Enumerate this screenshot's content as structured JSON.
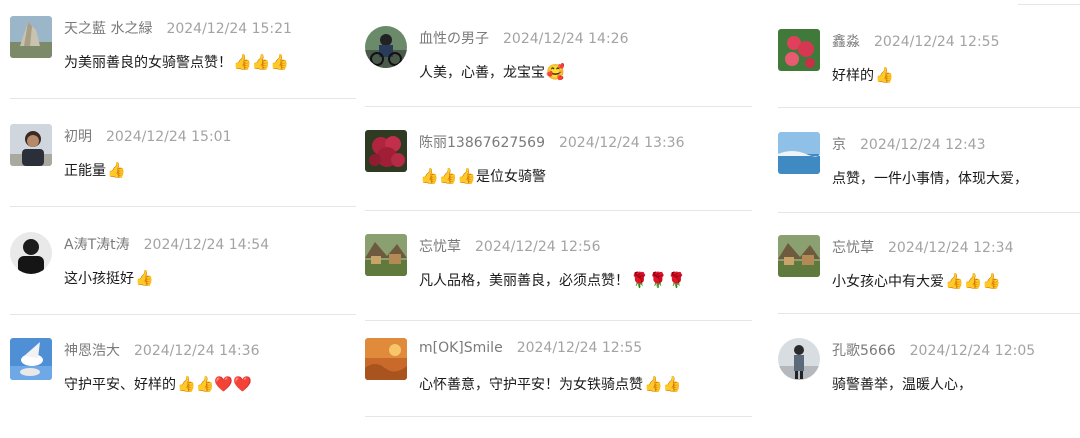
{
  "columns": [
    {
      "comments": [
        {
          "user": "天之藍 水之緑",
          "time": "2024/12/24 15:21",
          "text": "为美丽善良的女骑警点赞！",
          "emojis": "👍👍👍"
        },
        {
          "user": "初明",
          "time": "2024/12/24 15:01",
          "text": "正能量",
          "emojis": "👍"
        },
        {
          "user": "A涛T涛t涛",
          "time": "2024/12/24 14:54",
          "text": "这小孩挺好",
          "emojis": "👍"
        },
        {
          "user": "神恩浩大",
          "time": "2024/12/24 14:36",
          "text": "守护平安、好样的",
          "emojis": "👍👍❤️❤️"
        }
      ]
    },
    {
      "comments": [
        {
          "user": "血性の男子",
          "time": "2024/12/24 14:26",
          "text": "人美，心善，龙宝宝",
          "emojis": "🥰"
        },
        {
          "user": "陈丽13867627569",
          "time": "2024/12/24 13:36",
          "text": "是位女骑警",
          "emojis_before": "👍👍👍"
        },
        {
          "user": "忘忧草",
          "time": "2024/12/24 12:56",
          "text": "凡人品格，美丽善良，必须点赞！",
          "emojis": "🌹🌹🌹"
        },
        {
          "user": "m[OK]Smile",
          "time": "2024/12/24 12:55",
          "text": "心怀善意，守护平安！为女铁骑点赞",
          "emojis": "👍👍"
        }
      ]
    },
    {
      "comments": [
        {
          "user": "鑫淼",
          "time": "2024/12/24 12:55",
          "text": "好样的",
          "emojis": "👍"
        },
        {
          "user": "京",
          "time": "2024/12/24 12:43",
          "text": "点赞，一件小事情，体现大爱，",
          "emojis": ""
        },
        {
          "user": "忘忧草",
          "time": "2024/12/24 12:34",
          "text": "小女孩心中有大爱",
          "emojis": "👍👍👍"
        },
        {
          "user": "孔歌5666",
          "time": "2024/12/24 12:05",
          "text": "骑警善举，温暖人心，",
          "emojis": ""
        }
      ]
    }
  ],
  "avatar_icons": [
    "landscape-avatar",
    "person-avatar",
    "dark-person-avatar",
    "dove-avatar",
    "cyclist-avatar",
    "flower-avatar",
    "village-avatar",
    "sunset-avatar",
    "red-flower-avatar",
    "seaside-avatar",
    "village-avatar",
    "standing-person-avatar"
  ]
}
